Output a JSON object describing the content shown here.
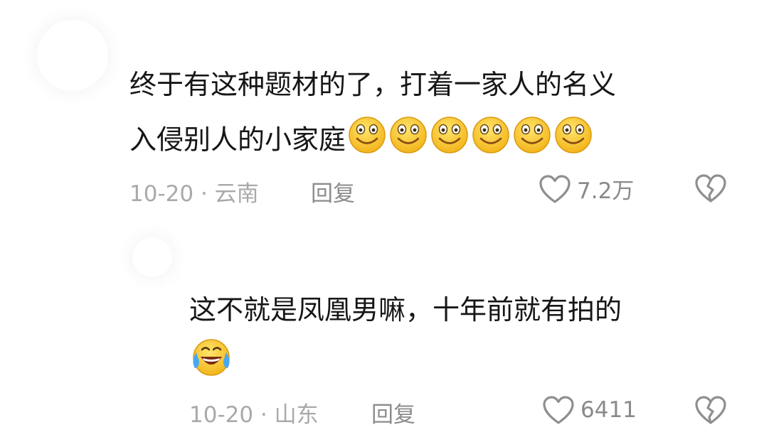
{
  "comments": [
    {
      "text_line1": "终于有这种题材的了，打着一家人的名义",
      "text_line2": "入侵别人的小家庭",
      "emojis": [
        "smile-emoji",
        "smile-emoji",
        "smile-emoji",
        "smile-emoji",
        "smile-emoji",
        "smile-emoji"
      ],
      "date": "10-20",
      "sep": "·",
      "location": "云南",
      "reply_label": "回复",
      "likes": "7.2万"
    },
    {
      "text_line1": "这不就是凤凰男嘛，十年前就有拍的",
      "emojis": [
        "laugh-cry-emoji"
      ],
      "date": "10-20",
      "sep": "·",
      "location": "山东",
      "reply_label": "回复",
      "likes": "6411"
    }
  ]
}
